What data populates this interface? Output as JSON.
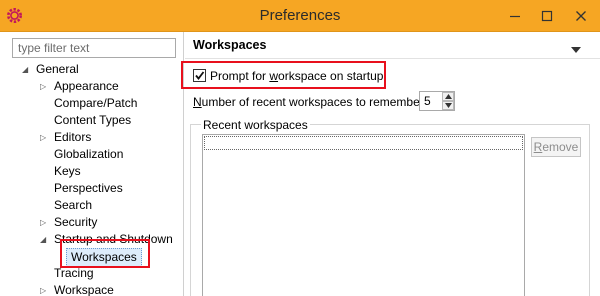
{
  "window": {
    "title": "Preferences",
    "icon": "eclipse-gear-icon",
    "titlebar_color": "#f6a623"
  },
  "sidebar": {
    "filter_placeholder": "type filter text",
    "tree": [
      {
        "label": "General",
        "level": 0,
        "twisty": "expanded"
      },
      {
        "label": "Appearance",
        "level": 1,
        "twisty": "collapsed"
      },
      {
        "label": "Compare/Patch",
        "level": 1,
        "twisty": "none"
      },
      {
        "label": "Content Types",
        "level": 1,
        "twisty": "none"
      },
      {
        "label": "Editors",
        "level": 1,
        "twisty": "collapsed"
      },
      {
        "label": "Globalization",
        "level": 1,
        "twisty": "none"
      },
      {
        "label": "Keys",
        "level": 1,
        "twisty": "none"
      },
      {
        "label": "Perspectives",
        "level": 1,
        "twisty": "none"
      },
      {
        "label": "Search",
        "level": 1,
        "twisty": "none"
      },
      {
        "label": "Security",
        "level": 1,
        "twisty": "collapsed"
      },
      {
        "label": "Startup and Shutdown",
        "level": 1,
        "twisty": "expanded"
      },
      {
        "label": "Workspaces",
        "level": 2,
        "twisty": "none",
        "selected": true
      },
      {
        "label": "Tracing",
        "level": 1,
        "twisty": "none"
      },
      {
        "label": "Workspace",
        "level": 1,
        "twisty": "collapsed"
      }
    ]
  },
  "page": {
    "title": "Workspaces",
    "prompt_checkbox": {
      "label_pre": "Prompt for ",
      "label_mnemonic": "w",
      "label_post": "orkspace on startup",
      "checked": true
    },
    "recent_count": {
      "label_mnemonic": "N",
      "label_post": "umber of recent workspaces to remember:",
      "value": "5"
    },
    "recent_group": {
      "label": "Recent workspaces",
      "remove_mnemonic": "R",
      "remove_post": "emove"
    }
  },
  "annotations": {
    "highlight_color": "#e8101d"
  }
}
